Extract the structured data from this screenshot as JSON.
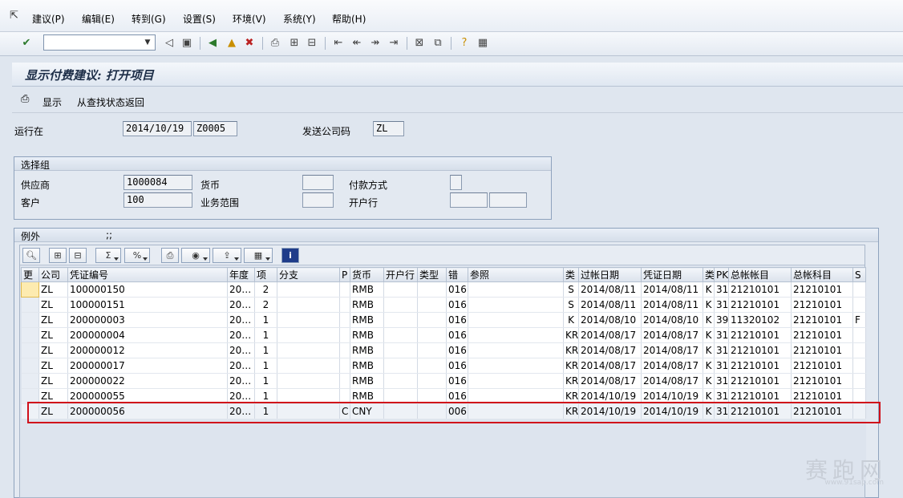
{
  "menu": {
    "items": [
      "建议(P)",
      "编辑(E)",
      "转到(G)",
      "设置(S)",
      "环境(V)",
      "系统(Y)",
      "帮助(H)"
    ]
  },
  "toolbar": {
    "command_value": "",
    "icons": [
      "enter-icon",
      "back-icon",
      "save-icon",
      "navigate-back-icon",
      "exit-icon",
      "cancel-icon",
      "print-icon",
      "find-icon",
      "find-next-icon",
      "first-page-icon",
      "prev-page-icon",
      "next-page-icon",
      "last-page-icon",
      "new-session-icon",
      "shortcut-icon",
      "help-icon",
      "layout-icon"
    ]
  },
  "title": "显示付费建议: 打开项目",
  "app_toolbar": {
    "display_label": "显示",
    "return_label": "从查找状态返回"
  },
  "header": {
    "run_label": "运行在",
    "run_date": "2014/10/19",
    "run_id": "Z0005",
    "company_label": "发送公司码",
    "company_value": "ZL"
  },
  "selection": {
    "title": "选择组",
    "vendor_label": "供应商",
    "vendor_value": "1000084",
    "currency_label": "货币",
    "currency_value": "",
    "payment_method_label": "付款方式",
    "payment_method_value": "",
    "customer_label": "客户",
    "customer_value": "100",
    "business_area_label": "业务范围",
    "business_area_value": "",
    "house_bank_label": "开户行",
    "house_bank_value1": "",
    "house_bank_value2": ""
  },
  "exceptions": {
    "title": "例外",
    "title_suffix": ";;"
  },
  "grid": {
    "columns": [
      "更",
      "公司",
      "凭证编号",
      "年度",
      "项",
      "分支",
      "P",
      "货币",
      "开户行",
      "类型",
      "错",
      "参照",
      "类",
      "过帐日期",
      "凭证日期",
      "类",
      "PK",
      "总帐帐目",
      "总帐科目",
      "S"
    ],
    "rows": [
      [
        "",
        "ZL",
        "100000150",
        "20…",
        "2",
        "",
        "",
        "RMB",
        "",
        "",
        "016",
        "",
        "S",
        "2014/08/11",
        "2014/08/11",
        "K",
        "31",
        "21210101",
        "21210101",
        ""
      ],
      [
        "",
        "ZL",
        "100000151",
        "20…",
        "2",
        "",
        "",
        "RMB",
        "",
        "",
        "016",
        "",
        "S",
        "2014/08/11",
        "2014/08/11",
        "K",
        "31",
        "21210101",
        "21210101",
        ""
      ],
      [
        "",
        "ZL",
        "200000003",
        "20…",
        "1",
        "",
        "",
        "RMB",
        "",
        "",
        "016",
        "",
        "K",
        "2014/08/10",
        "2014/08/10",
        "K",
        "39",
        "11320102",
        "21210101",
        "F"
      ],
      [
        "",
        "ZL",
        "200000004",
        "20…",
        "1",
        "",
        "",
        "RMB",
        "",
        "",
        "016",
        "",
        "KR",
        "2014/08/17",
        "2014/08/17",
        "K",
        "31",
        "21210101",
        "21210101",
        ""
      ],
      [
        "",
        "ZL",
        "200000012",
        "20…",
        "1",
        "",
        "",
        "RMB",
        "",
        "",
        "016",
        "",
        "KR",
        "2014/08/17",
        "2014/08/17",
        "K",
        "31",
        "21210101",
        "21210101",
        ""
      ],
      [
        "",
        "ZL",
        "200000017",
        "20…",
        "1",
        "",
        "",
        "RMB",
        "",
        "",
        "016",
        "",
        "KR",
        "2014/08/17",
        "2014/08/17",
        "K",
        "31",
        "21210101",
        "21210101",
        ""
      ],
      [
        "",
        "ZL",
        "200000022",
        "20…",
        "1",
        "",
        "",
        "RMB",
        "",
        "",
        "016",
        "",
        "KR",
        "2014/08/17",
        "2014/08/17",
        "K",
        "31",
        "21210101",
        "21210101",
        ""
      ],
      [
        "",
        "ZL",
        "200000055",
        "20…",
        "1",
        "",
        "",
        "RMB",
        "",
        "",
        "016",
        "",
        "KR",
        "2014/10/19",
        "2014/10/19",
        "K",
        "31",
        "21210101",
        "21210101",
        ""
      ],
      [
        "",
        "ZL",
        "200000056",
        "20…",
        "1",
        "",
        "C",
        "CNY",
        "",
        "",
        "006",
        "",
        "KR",
        "2014/10/19",
        "2014/10/19",
        "K",
        "31",
        "21210101",
        "21210101",
        ""
      ]
    ]
  },
  "watermark": {
    "text": "赛跑网",
    "url": "www.91sap.com"
  },
  "colors": {
    "highlight": "#d0101a",
    "selected_cell": "#fdebb0"
  }
}
